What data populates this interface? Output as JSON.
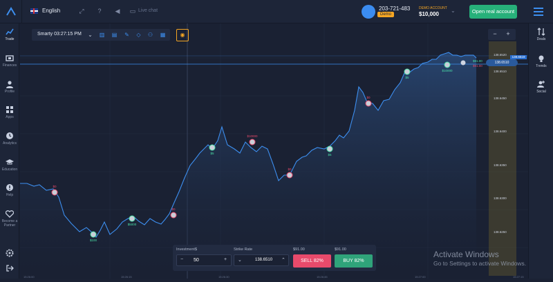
{
  "header": {
    "language": "English",
    "live_chat": "Live chat",
    "account_id": "203-721-483",
    "demo_badge": "Demo",
    "account_type": "DEMO ACCOUNT",
    "balance": "$10,000",
    "open_real_label": "Open real account"
  },
  "sidebar": {
    "items": [
      {
        "label": "Trade",
        "icon": "trade-chart-icon"
      },
      {
        "label": "Finances",
        "icon": "wallet-icon"
      },
      {
        "label": "Profile",
        "icon": "user-icon"
      },
      {
        "label": "Apps",
        "icon": "apps-grid-icon"
      },
      {
        "label": "Analytics",
        "icon": "clock-icon"
      },
      {
        "label": "Education",
        "icon": "graduation-cap-icon"
      },
      {
        "label": "Help",
        "icon": "help-icon"
      },
      {
        "label": "Become a Partner",
        "icon": "heart-icon"
      }
    ]
  },
  "right_sidebar": {
    "items": [
      {
        "label": "Deals",
        "icon": "deals-arrows-icon"
      },
      {
        "label": "Trends",
        "icon": "bulb-icon"
      },
      {
        "label": "Social",
        "icon": "add-user-icon"
      }
    ]
  },
  "toolbar": {
    "asset_time": "Smarty 03:27:15 PM"
  },
  "price_axis": {
    "labels": [
      "138.6520",
      "138.6510",
      "138.6450",
      "138.6400",
      "138.6350",
      "138.6300",
      "138.6250",
      "138.6200",
      "138.6150"
    ],
    "current_price": "138.6510",
    "right_price": "138.6519",
    "side_up": "$91.00",
    "side_down": "$91.00"
  },
  "trade_panel": {
    "investment_label": "Investment",
    "investment_currency": "$",
    "investment_value": "50",
    "strike_label": "Strike Rate",
    "strike_value": "138.6510",
    "sell_payout": "$91.00",
    "buy_payout": "$91.00",
    "sell_label": "SELL 82%",
    "buy_label": "BUY 82%"
  },
  "time_axis": [
    "15:26:00",
    "15:26:15",
    "15:26:30",
    "15:26:45",
    "15:27:00",
    "15:27:15"
  ],
  "markers": [
    {
      "label": "$0",
      "color": "#e84a6b"
    },
    {
      "label": "$100",
      "color": "#4be0a8"
    },
    {
      "label": "$5000",
      "color": "#4be0a8"
    },
    {
      "label": "$0",
      "color": "#e84a6b"
    },
    {
      "label": "$5",
      "color": "#4be0a8"
    },
    {
      "label": "$10000",
      "color": "#e84a6b"
    },
    {
      "label": "$0",
      "color": "#e84a6b"
    },
    {
      "label": "$5",
      "color": "#4be0a8"
    },
    {
      "label": "$0",
      "color": "#e84a6b"
    },
    {
      "label": "$5",
      "color": "#4be0a8"
    },
    {
      "label": "$10000",
      "color": "#4be0a8"
    }
  ],
  "watermark": {
    "title": "Activate Windows",
    "subtitle": "Go to Settings to activate Windows."
  },
  "colors": {
    "accent": "#3d8ff0",
    "sell": "#e84a6b",
    "buy": "#2fa37a",
    "demo": "#f5a623",
    "open_real": "#27b07a"
  }
}
